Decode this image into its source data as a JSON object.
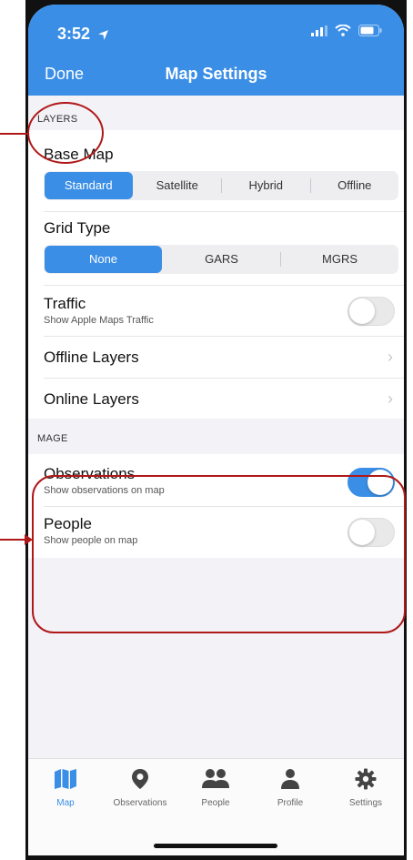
{
  "status_bar": {
    "time": "3:52",
    "location_icon": "location-arrow-icon",
    "signal_icon": "signal-icon",
    "wifi_icon": "wifi-icon",
    "battery_icon": "battery-icon"
  },
  "nav": {
    "done_label": "Done",
    "title": "Map Settings"
  },
  "layers": {
    "header": "LAYERS",
    "base_map": {
      "label": "Base Map",
      "options": [
        "Standard",
        "Satellite",
        "Hybrid",
        "Offline"
      ],
      "selected": "Standard"
    },
    "grid_type": {
      "label": "Grid Type",
      "options": [
        "None",
        "GARS",
        "MGRS"
      ],
      "selected": "None"
    },
    "traffic": {
      "label": "Traffic",
      "sublabel": "Show Apple Maps Traffic",
      "enabled": false
    },
    "offline_layers_label": "Offline Layers",
    "online_layers_label": "Online Layers"
  },
  "mage": {
    "header": "MAGE",
    "observations": {
      "label": "Observations",
      "sublabel": "Show observations on map",
      "enabled": true
    },
    "people": {
      "label": "People",
      "sublabel": "Show people on map",
      "enabled": false
    }
  },
  "tabbar": {
    "items": [
      {
        "label": "Map",
        "icon": "map-icon",
        "active": true
      },
      {
        "label": "Observations",
        "icon": "map-pin-icon",
        "active": false
      },
      {
        "label": "People",
        "icon": "people-icon",
        "active": false
      },
      {
        "label": "Profile",
        "icon": "person-icon",
        "active": false
      },
      {
        "label": "Settings",
        "icon": "gear-icon",
        "active": false
      }
    ]
  },
  "colors": {
    "accent": "#3a8ee6",
    "annotation": "#b01818",
    "background": "#f2f2f7"
  }
}
